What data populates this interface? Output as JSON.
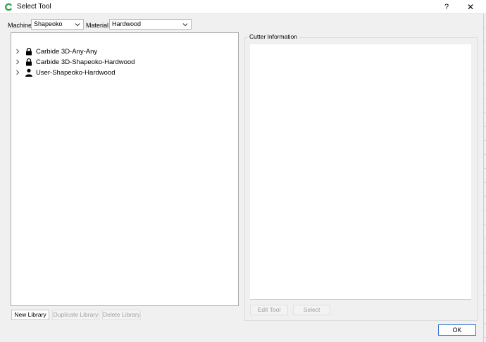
{
  "window": {
    "title": "Select Tool",
    "help_label": "?",
    "close_label": "✕"
  },
  "filters": {
    "machine_label": "Machine",
    "machine_value": "Shapeoko",
    "material_label": "Material",
    "material_value": "Hardwood"
  },
  "tree": {
    "items": [
      {
        "label": "Carbide 3D-Any-Any",
        "icon": "lock-icon"
      },
      {
        "label": "Carbide 3D-Shapeoko-Hardwood",
        "icon": "lock-icon"
      },
      {
        "label": "User-Shapeoko-Hardwood",
        "icon": "user-icon"
      }
    ]
  },
  "library_buttons": {
    "new": "New Library",
    "duplicate": "Duplicate Library",
    "delete": "Delete Library"
  },
  "cutter_info": {
    "title": "Cutter Information",
    "edit_label": "Edit Tool",
    "select_label": "Select"
  },
  "footer": {
    "ok_label": "OK"
  },
  "colors": {
    "accent": "#2f6fd1",
    "app_icon": "#2fa84f",
    "disabled_text": "#a0a0a0"
  }
}
